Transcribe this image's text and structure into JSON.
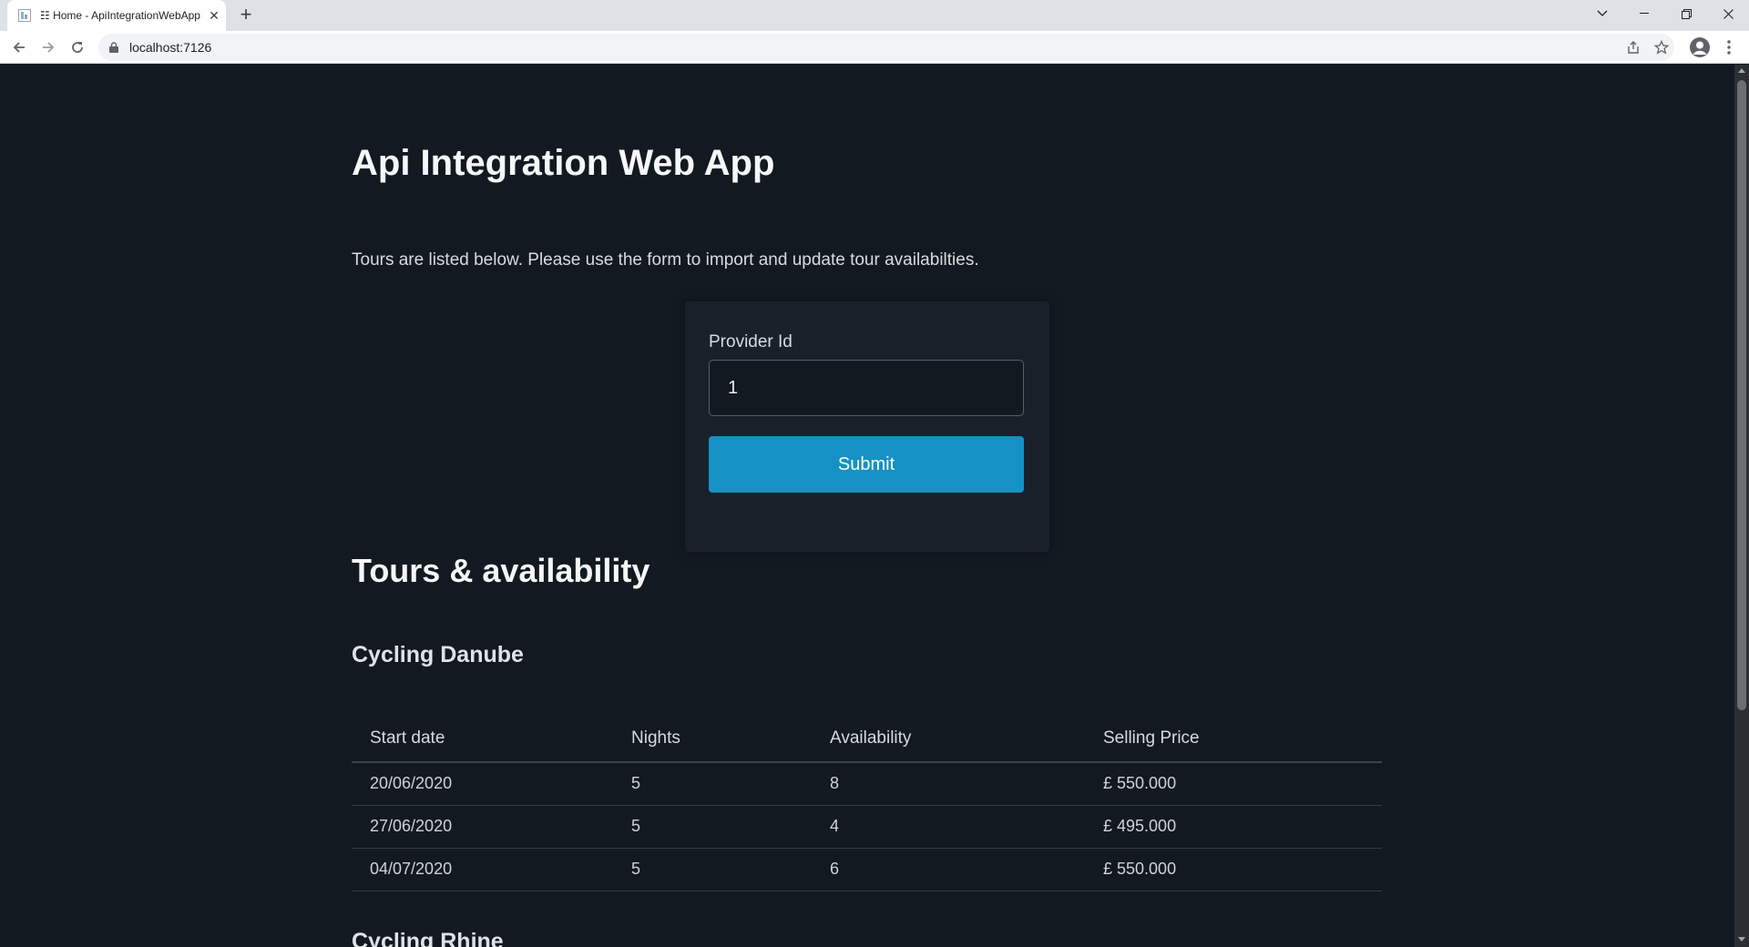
{
  "browser": {
    "tab_title": "☷ Home - ApiIntegrationWebApp",
    "url": "localhost:7126"
  },
  "page": {
    "title": "Api Integration Web App",
    "intro": "Tours are listed below. Please use the form to import and update tour availabilties."
  },
  "form": {
    "label": "Provider Id",
    "value": "1",
    "submit_label": "Submit"
  },
  "tours": {
    "section_title": "Tours & availability",
    "headers": [
      "Start date",
      "Nights",
      "Availability",
      "Selling Price"
    ],
    "list": [
      {
        "name": "Cycling Danube",
        "rows": [
          [
            "20/06/2020",
            "5",
            "8",
            "£ 550.000"
          ],
          [
            "27/06/2020",
            "5",
            "4",
            "£ 495.000"
          ],
          [
            "04/07/2020",
            "5",
            "6",
            "£ 550.000"
          ]
        ]
      },
      {
        "name": "Cycling Rhine",
        "rows": []
      }
    ]
  },
  "colors": {
    "background": "#121920",
    "card": "#18212a",
    "accent": "#1592c3"
  }
}
